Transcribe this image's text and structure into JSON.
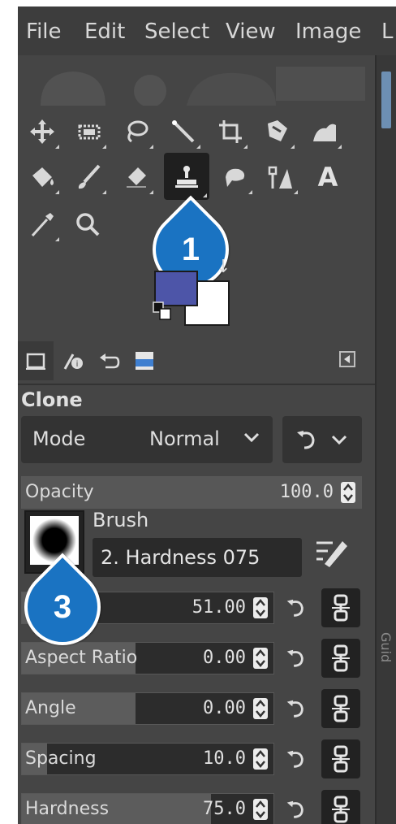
{
  "menu": {
    "items": [
      "File",
      "Edit",
      "Select",
      "View",
      "Image",
      "L"
    ]
  },
  "toolbox": {
    "text_tool_glyph": "A",
    "active_tool": "clone-tool"
  },
  "callouts": {
    "first": "1",
    "third": "3"
  },
  "colors": {
    "foreground": "#4d55a8",
    "background": "#ffffff",
    "accent": "#1a73c2"
  },
  "tool_options": {
    "title": "Clone",
    "mode_label": "Mode",
    "mode_value": "Normal",
    "opacity": {
      "label": "Opacity",
      "value": "100.0",
      "fraction": 1.0
    },
    "brush_label": "Brush",
    "brush_name": "2. Hardness 075",
    "size": {
      "label": "",
      "value": "51.00"
    },
    "aspect_ratio": {
      "label": "Aspect Ratio",
      "value": "0.00"
    },
    "angle": {
      "label": "Angle",
      "value": "0.00"
    },
    "spacing": {
      "label": "Spacing",
      "value": "10.0"
    },
    "hardness": {
      "label": "Hardness",
      "value": "75.0"
    }
  },
  "side_panel": {
    "vertical_text": "Guid"
  }
}
